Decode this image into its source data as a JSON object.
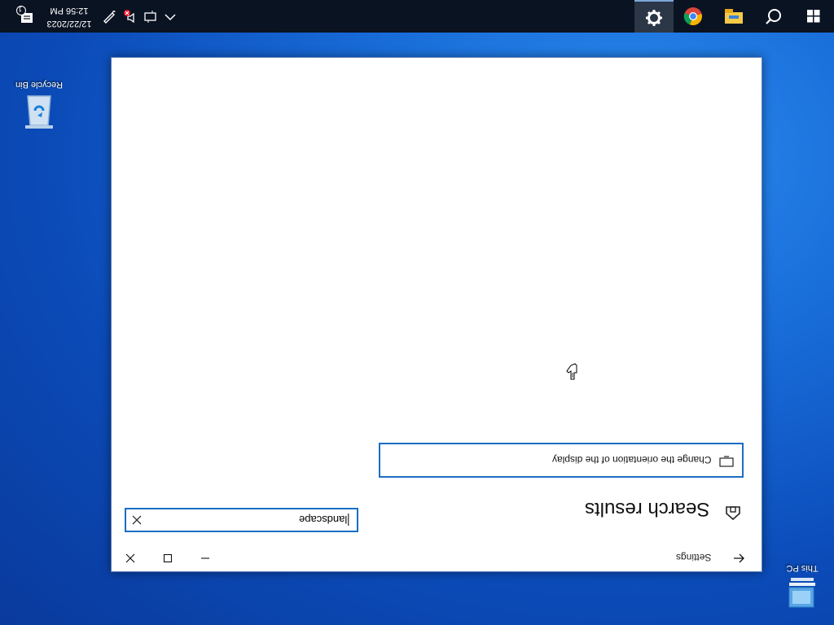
{
  "taskbar": {
    "clock_time": "12:56 PM",
    "clock_date": "12/22/2023",
    "notification_count": "1",
    "pinned": [
      {
        "name": "settings",
        "active": true
      },
      {
        "name": "chrome",
        "active": false
      },
      {
        "name": "file-explorer",
        "active": false
      },
      {
        "name": "search",
        "active": false
      },
      {
        "name": "start",
        "active": false
      }
    ]
  },
  "desktop": {
    "recycle_bin_label": "Recycle Bin",
    "this_pc_label": "This PC"
  },
  "window": {
    "title": "Settings",
    "heading": "Search results",
    "search": {
      "value": "landscape"
    },
    "results": [
      {
        "label": "Change the orientation of the display"
      }
    ]
  },
  "colors": {
    "accent": "#1a6fc2",
    "taskbar": "#0a1322"
  }
}
